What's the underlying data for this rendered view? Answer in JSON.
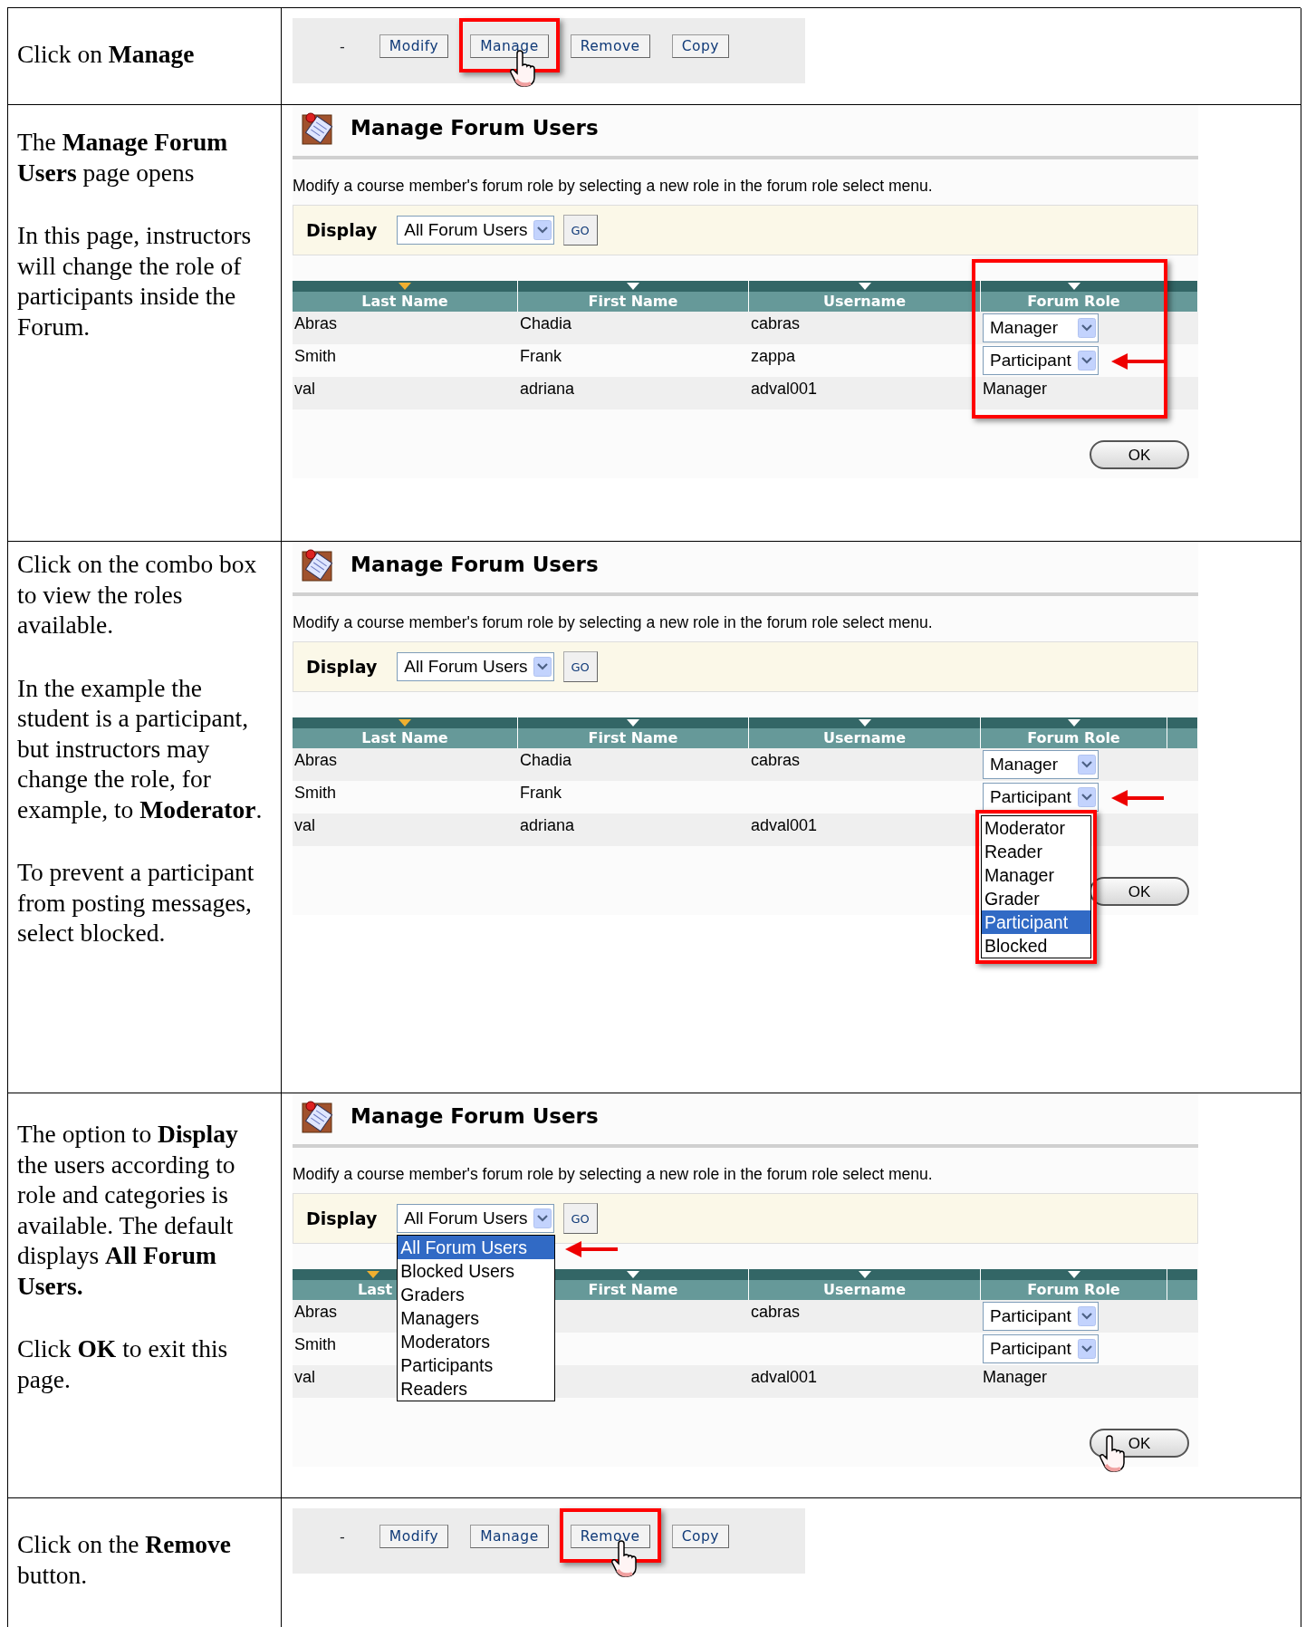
{
  "rows": [
    {
      "instruction": [
        "Click on **Manage**"
      ],
      "screen": {
        "kind": "toolbar",
        "dash": "-",
        "buttons": [
          {
            "label": "Modify",
            "highlighted": false,
            "pointer": false
          },
          {
            "label": "Manage",
            "highlighted": true,
            "pointer": true
          },
          {
            "label": "Remove",
            "highlighted": false,
            "pointer": false
          },
          {
            "label": "Copy",
            "highlighted": false,
            "pointer": false
          }
        ]
      }
    },
    {
      "instruction": [
        "The **Manage Forum Users** page opens",
        "In this page, instructors will change the role of participants inside the Forum."
      ],
      "screen": {
        "kind": "manage",
        "title": "Manage Forum Users",
        "description": "Modify a course member's forum role by selecting a new role in the forum role select menu.",
        "display_label": "Display",
        "display_value": "All Forum Users",
        "go_label": "GO",
        "role_column_highlighted": true,
        "columns": [
          {
            "label": "Last Name",
            "sorted": true
          },
          {
            "label": "First Name",
            "sorted": false
          },
          {
            "label": "Username",
            "sorted": false
          },
          {
            "label": "Forum Role",
            "sorted": false
          }
        ],
        "users": [
          {
            "last_name": "Abras",
            "first_name": "Chadia",
            "username": "cabras",
            "role": {
              "kind": "select",
              "value": "Manager"
            },
            "arrow": false
          },
          {
            "last_name": "Smith",
            "first_name": "Frank",
            "username": "zappa",
            "role": {
              "kind": "select",
              "value": "Participant"
            },
            "arrow": true
          },
          {
            "last_name": "val",
            "first_name": "adriana",
            "username": "adval001",
            "role": {
              "kind": "text",
              "value": "Manager"
            },
            "arrow": false
          }
        ],
        "ok_label": "OK",
        "ok_pointer": false
      }
    },
    {
      "instruction": [
        "Click on the combo box to view the roles available.",
        "In the example the student is a participant, but instructors may change the role, for example, to **Moderator**.",
        "To prevent a participant from posting messages, select blocked."
      ],
      "screen": {
        "kind": "manage",
        "title": "Manage Forum Users",
        "description": "Modify a course member's forum role by selecting a new role in the forum role select menu.",
        "display_label": "Display",
        "display_value": "All Forum Users",
        "go_label": "GO",
        "role_column_highlighted": false,
        "columns": [
          {
            "label": "Last Name",
            "sorted": true
          },
          {
            "label": "First Name",
            "sorted": false
          },
          {
            "label": "Username",
            "sorted": false
          },
          {
            "label": "Forum Role",
            "sorted": false
          }
        ],
        "users": [
          {
            "last_name": "Abras",
            "first_name": "Chadia",
            "username": "cabras",
            "role": {
              "kind": "select",
              "value": "Manager"
            },
            "arrow": false
          },
          {
            "last_name": "Smith",
            "first_name": "Frank",
            "role": {
              "kind": "select",
              "value": "Participant",
              "menu": {
                "highlighted": true,
                "options": [
                  {
                    "label": "Moderator",
                    "selected": false
                  },
                  {
                    "label": "Reader",
                    "selected": false
                  },
                  {
                    "label": "Manager",
                    "selected": false
                  },
                  {
                    "label": "Grader",
                    "selected": false
                  },
                  {
                    "label": "Participant",
                    "selected": true
                  },
                  {
                    "label": "Blocked",
                    "selected": false
                  }
                ]
              }
            },
            "arrow": true
          },
          {
            "last_name": "val",
            "first_name": "adriana",
            "username": "adval001",
            "arrow": false
          }
        ],
        "ok_label": "OK",
        "ok_pointer": false
      }
    },
    {
      "instruction": [
        "The option to **Display** the users according to role and categories is available. The default displays **All Forum Users.**",
        "Click **OK** to exit this page."
      ],
      "screen": {
        "kind": "manage",
        "title": "Manage Forum Users",
        "description": "Modify a course member's forum role by selecting a new role in the forum role select menu.",
        "display_label": "Display",
        "display_value": "All Forum Users",
        "go_label": "GO",
        "role_column_highlighted": false,
        "display_menu": {
          "arrow": true,
          "options": [
            {
              "label": "All Forum Users",
              "selected": true
            },
            {
              "label": "Blocked Users",
              "selected": false
            },
            {
              "label": "Graders",
              "selected": false
            },
            {
              "label": "Managers",
              "selected": false
            },
            {
              "label": "Moderators",
              "selected": false
            },
            {
              "label": "Participants",
              "selected": false
            },
            {
              "label": "Readers",
              "selected": false
            }
          ]
        },
        "columns": [
          {
            "label": "Last",
            "sorted": true
          },
          {
            "label": "First Name",
            "sorted": false
          },
          {
            "label": "Username",
            "sorted": false
          },
          {
            "label": "Forum Role",
            "sorted": false
          }
        ],
        "users": [
          {
            "last_name": "Abras",
            "username": "cabras",
            "role": {
              "kind": "select",
              "value": "Participant"
            },
            "arrow": false
          },
          {
            "last_name": "Smith",
            "role": {
              "kind": "select",
              "value": "Participant"
            },
            "arrow": false
          },
          {
            "last_name": "val",
            "username": "adval001",
            "role": {
              "kind": "text",
              "value": "Manager"
            },
            "arrow": false
          }
        ],
        "ok_label": "OK",
        "ok_pointer": true
      }
    },
    {
      "instruction": [
        "Click on the **Remove** button."
      ],
      "screen": {
        "kind": "toolbar",
        "dash": "-",
        "buttons": [
          {
            "label": "Modify",
            "highlighted": false,
            "pointer": false
          },
          {
            "label": "Manage",
            "highlighted": false,
            "pointer": false
          },
          {
            "label": "Remove",
            "highlighted": true,
            "pointer": true
          },
          {
            "label": "Copy",
            "highlighted": false,
            "pointer": false
          }
        ]
      }
    }
  ]
}
